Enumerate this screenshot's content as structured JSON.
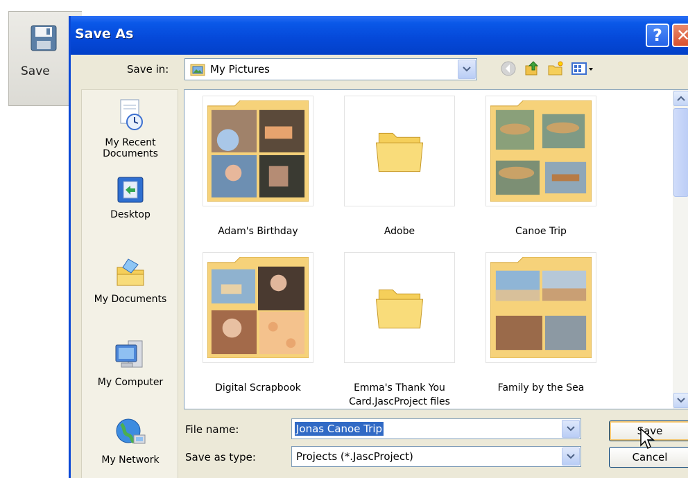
{
  "background_toolbar": {
    "save_label": "Save"
  },
  "dialog": {
    "title": "Save As",
    "help_glyph": "?",
    "close_glyph": "✕",
    "save_in_label": "Save in:",
    "save_in_value": "My Pictures",
    "places": [
      {
        "label": "My Recent Documents",
        "icon": "recent-documents-icon"
      },
      {
        "label": "Desktop",
        "icon": "desktop-icon"
      },
      {
        "label": "My Documents",
        "icon": "my-documents-icon"
      },
      {
        "label": "My Computer",
        "icon": "my-computer-icon"
      },
      {
        "label": "My Network",
        "icon": "my-network-icon"
      }
    ],
    "files": [
      {
        "label": "Adam's Birthday",
        "kind": "photo-folder"
      },
      {
        "label": "Adobe",
        "kind": "folder"
      },
      {
        "label": "Canoe Trip",
        "kind": "photo-folder"
      },
      {
        "label": "Digital Scrapbook",
        "kind": "photo-folder"
      },
      {
        "label": "Emma's Thank You Card.JascProject files",
        "kind": "folder"
      },
      {
        "label": "Family by the Sea",
        "kind": "photo-folder"
      }
    ],
    "file_name_label": "File name:",
    "file_name_value": "Jonas Canoe Trip",
    "save_as_type_label": "Save as type:",
    "save_as_type_value": "Projects (*.JascProject)",
    "save_button": "Save",
    "cancel_button": "Cancel"
  }
}
